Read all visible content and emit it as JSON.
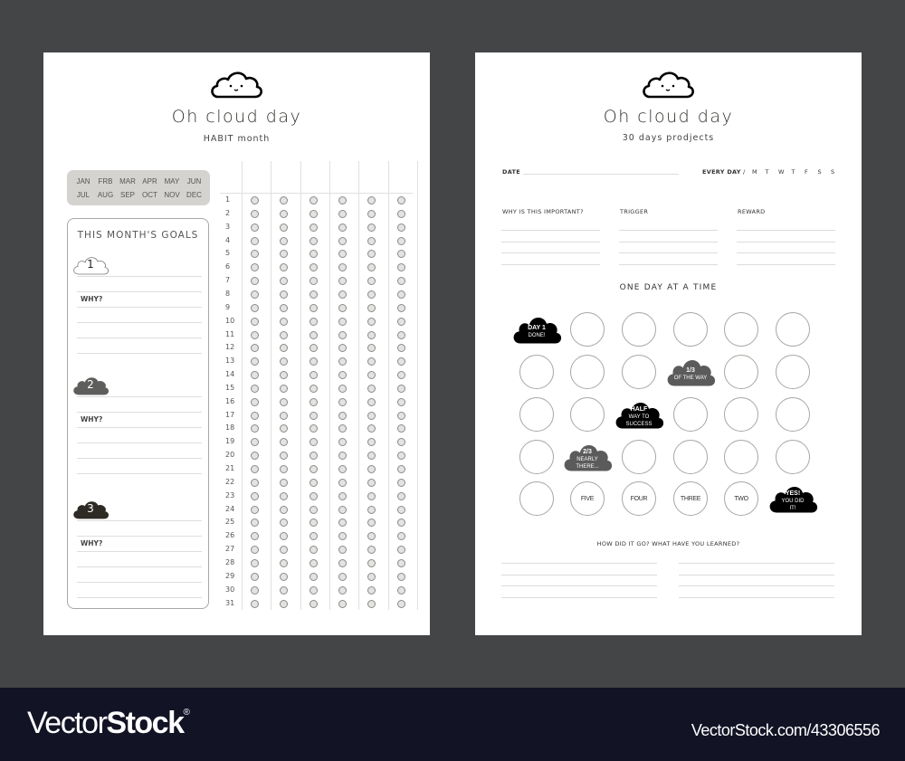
{
  "habit_page": {
    "title": "Oh cloud day",
    "subtitle": "HABIT month",
    "months": [
      "JAN",
      "FRB",
      "MAR",
      "APR",
      "MAY",
      "JUN",
      "JUL",
      "AUG",
      "SEP",
      "OCT",
      "NOV",
      "DEC"
    ],
    "goals_title": "THIS MONTH'S GOALS",
    "goals": [
      {
        "number": "1",
        "why_label": "WHY?",
        "cloud_color": "#ffffff"
      },
      {
        "number": "2",
        "why_label": "WHY?",
        "cloud_color": "#5e5e5c"
      },
      {
        "number": "3",
        "why_label": "WHY?",
        "cloud_color": "#2d2b24"
      }
    ],
    "habit_columns": 6,
    "days": [
      "1",
      "2",
      "3",
      "4",
      "5",
      "6",
      "7",
      "8",
      "9",
      "10",
      "11",
      "12",
      "13",
      "14",
      "15",
      "16",
      "17",
      "18",
      "19",
      "20",
      "21",
      "22",
      "23",
      "24",
      "25",
      "26",
      "27",
      "28",
      "29",
      "30",
      "31"
    ]
  },
  "project_page": {
    "title": "Oh cloud day",
    "subtitle": "30 days prodjects",
    "date_label": "DATE",
    "every_day_label": "EVERY DAY",
    "separator": "/",
    "weekdays": [
      "M",
      "T",
      "W",
      "T",
      "F",
      "S",
      "S"
    ],
    "prompts": [
      "WHY IS THIS IMPORTANT?",
      "TRIGGER",
      "REWARD"
    ],
    "one_day_title": "ONE DAY AT A TIME",
    "grid": [
      [
        {
          "type": "badge",
          "color": "#000000",
          "lines": [
            "DAY 1",
            "DONE!"
          ]
        },
        {
          "type": "ring",
          "text": ""
        },
        {
          "type": "ring",
          "text": ""
        },
        {
          "type": "ring",
          "text": ""
        },
        {
          "type": "ring",
          "text": ""
        },
        {
          "type": "ring",
          "text": ""
        }
      ],
      [
        {
          "type": "ring",
          "text": ""
        },
        {
          "type": "ring",
          "text": ""
        },
        {
          "type": "ring",
          "text": ""
        },
        {
          "type": "badge",
          "color": "#5b5b5b",
          "lines": [
            "1/3",
            "OF THE WAY"
          ]
        },
        {
          "type": "ring",
          "text": ""
        },
        {
          "type": "ring",
          "text": ""
        }
      ],
      [
        {
          "type": "ring",
          "text": ""
        },
        {
          "type": "ring",
          "text": ""
        },
        {
          "type": "badge",
          "color": "#000000",
          "lines": [
            "HALF",
            "WAY TO",
            "SUCCESS"
          ]
        },
        {
          "type": "ring",
          "text": ""
        },
        {
          "type": "ring",
          "text": ""
        },
        {
          "type": "ring",
          "text": ""
        }
      ],
      [
        {
          "type": "ring",
          "text": ""
        },
        {
          "type": "badge",
          "color": "#5b5b5b",
          "lines": [
            "2/3",
            "NEARLY",
            "THERE..."
          ]
        },
        {
          "type": "ring",
          "text": ""
        },
        {
          "type": "ring",
          "text": ""
        },
        {
          "type": "ring",
          "text": ""
        },
        {
          "type": "ring",
          "text": ""
        }
      ],
      [
        {
          "type": "ring",
          "text": ""
        },
        {
          "type": "ring",
          "text": "FIVE"
        },
        {
          "type": "ring",
          "text": "FOUR"
        },
        {
          "type": "ring",
          "text": "THREE"
        },
        {
          "type": "ring",
          "text": "TWO"
        },
        {
          "type": "badge",
          "color": "#000000",
          "lines": [
            "YES!",
            "YOU DID",
            "IT!"
          ]
        }
      ]
    ],
    "review_title": "HOW DID IT GO?   WHAT HAVE YOU LEARNED?"
  },
  "footer": {
    "brand_light": "Vector",
    "brand_bold": "Stock",
    "brand_mark": "®",
    "url": "VectorStock.com/43306556"
  }
}
